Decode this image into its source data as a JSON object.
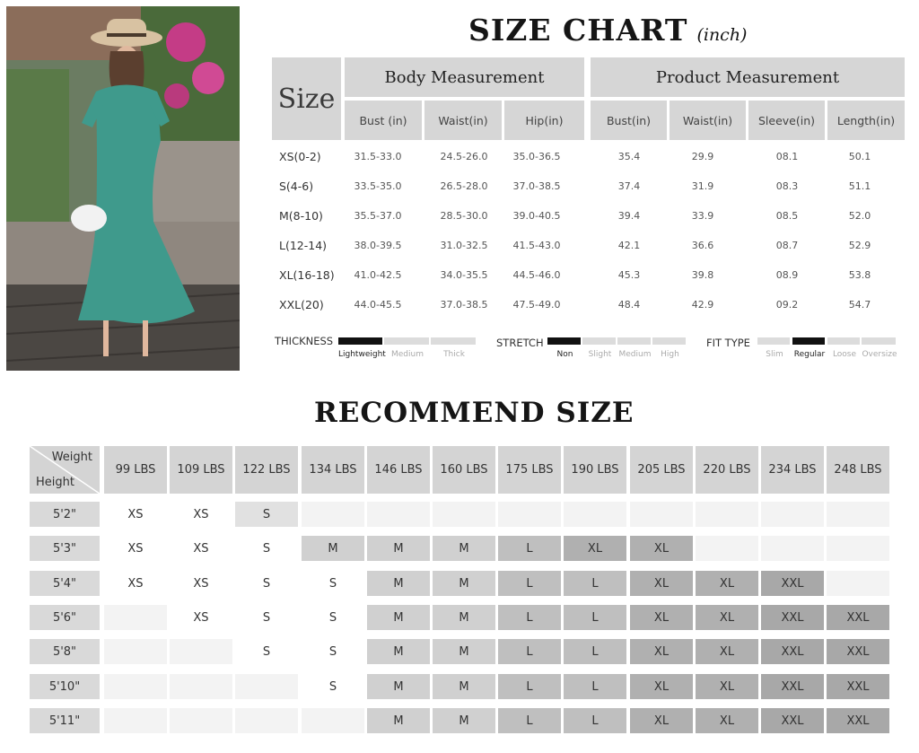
{
  "size_chart": {
    "title": "SIZE CHART",
    "unit": "(inch)",
    "size_header": "Size",
    "group_body": "Body Measurement",
    "group_product": "Product Measurement",
    "columns": [
      "Bust (in)",
      "Waist(in)",
      "Hip(in)",
      "Bust(in)",
      "Waist(in)",
      "Sleeve(in)",
      "Length(in)"
    ],
    "rows": [
      {
        "size": "XS(0-2)",
        "values": [
          "31.5-33.0",
          "24.5-26.0",
          "35.0-36.5",
          "35.4",
          "29.9",
          "08.1",
          "50.1"
        ]
      },
      {
        "size": "S(4-6)",
        "values": [
          "33.5-35.0",
          "26.5-28.0",
          "37.0-38.5",
          "37.4",
          "31.9",
          "08.3",
          "51.1"
        ]
      },
      {
        "size": "M(8-10)",
        "values": [
          "35.5-37.0",
          "28.5-30.0",
          "39.0-40.5",
          "39.4",
          "33.9",
          "08.5",
          "52.0"
        ]
      },
      {
        "size": "L(12-14)",
        "values": [
          "38.0-39.5",
          "31.0-32.5",
          "41.5-43.0",
          "42.1",
          "36.6",
          "08.7",
          "52.9"
        ]
      },
      {
        "size": "XL(16-18)",
        "values": [
          "41.0-42.5",
          "34.0-35.5",
          "44.5-46.0",
          "45.3",
          "39.8",
          "08.9",
          "53.8"
        ]
      },
      {
        "size": "XXL(20)",
        "values": [
          "44.0-45.5",
          "37.0-38.5",
          "47.5-49.0",
          "48.4",
          "42.9",
          "09.2",
          "54.7"
        ]
      }
    ]
  },
  "scales": [
    {
      "label": "THICKNESS",
      "options": [
        "Lightweight",
        "Medium",
        "Thick"
      ],
      "selected": 0
    },
    {
      "label": "STRETCH",
      "options": [
        "Non",
        "Slight",
        "Medium",
        "High"
      ],
      "selected": 0
    },
    {
      "label": "FIT TYPE",
      "options": [
        "Slim",
        "Regular",
        "Loose",
        "Oversize"
      ],
      "selected": 1
    }
  ],
  "recommend": {
    "title": "RECOMMEND SIZE",
    "corner_weight": "Weight",
    "corner_height": "Height",
    "weights": [
      "99 LBS",
      "109 LBS",
      "122 LBS",
      "134 LBS",
      "146 LBS",
      "160 LBS",
      "175 LBS",
      "190 LBS",
      "205 LBS",
      "220 LBS",
      "234 LBS",
      "248 LBS"
    ],
    "rows": [
      {
        "height": "5'2\"",
        "sizes": [
          "XS",
          "XS",
          "S",
          "",
          "",
          "",
          "",
          "",
          "",
          "",
          "",
          ""
        ]
      },
      {
        "height": "5'3\"",
        "sizes": [
          "XS",
          "XS",
          "S",
          "M",
          "M",
          "M",
          "L",
          "XL",
          "XL",
          "",
          "",
          ""
        ]
      },
      {
        "height": "5'4\"",
        "sizes": [
          "XS",
          "XS",
          "S",
          "S",
          "M",
          "M",
          "L",
          "L",
          "XL",
          "XL",
          "XXL",
          ""
        ]
      },
      {
        "height": "5'6\"",
        "sizes": [
          "",
          "XS",
          "S",
          "S",
          "M",
          "M",
          "L",
          "L",
          "XL",
          "XL",
          "XXL",
          "XXL"
        ]
      },
      {
        "height": "5'8\"",
        "sizes": [
          "",
          "",
          "S",
          "S",
          "M",
          "M",
          "L",
          "L",
          "XL",
          "XL",
          "XXL",
          "XXL"
        ]
      },
      {
        "height": "5'10\"",
        "sizes": [
          "",
          "",
          "",
          "S",
          "M",
          "M",
          "L",
          "L",
          "XL",
          "XL",
          "XXL",
          "XXL"
        ]
      },
      {
        "height": "5'11\"",
        "sizes": [
          "",
          "",
          "",
          "",
          "M",
          "M",
          "L",
          "L",
          "XL",
          "XL",
          "XXL",
          "XXL"
        ]
      }
    ]
  }
}
